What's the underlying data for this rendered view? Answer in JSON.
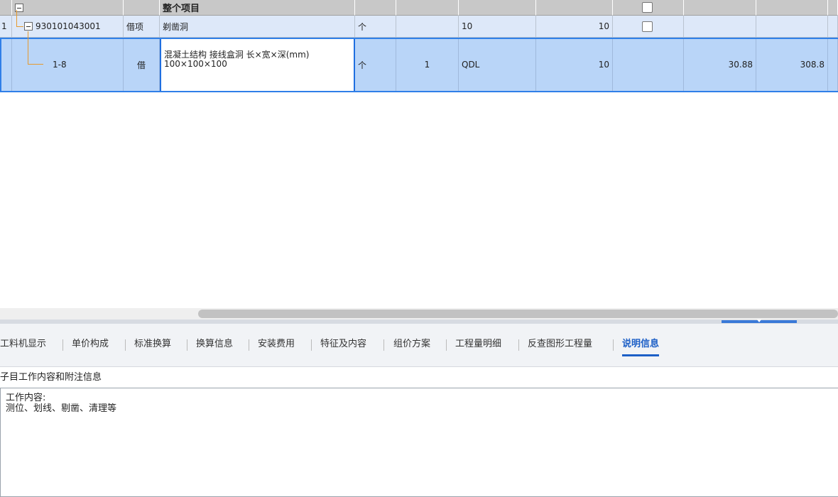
{
  "grid": {
    "header_row": {
      "name": "整个项目"
    },
    "list_row": {
      "num": "1",
      "code": "930101043001",
      "type": "借项",
      "name": "剃凿洞",
      "unit": "个",
      "quantity_expr": "10",
      "quantity": "10"
    },
    "sub_row": {
      "code": "1-8",
      "type": "借",
      "name": "混凝土结构 接线盒洞 长×宽×深(mm) 100×100×100",
      "unit": "个",
      "expr": "1",
      "quantity_expr": "QDL",
      "quantity": "10",
      "unit_price": "30.88",
      "total": "308.8"
    }
  },
  "tabs": [
    {
      "label": "工料机显示",
      "active": false
    },
    {
      "label": "单价构成",
      "active": false
    },
    {
      "label": "标准换算",
      "active": false
    },
    {
      "label": "换算信息",
      "active": false
    },
    {
      "label": "安装费用",
      "active": false
    },
    {
      "label": "特征及内容",
      "active": false
    },
    {
      "label": "组价方案",
      "active": false
    },
    {
      "label": "工程量明细",
      "active": false
    },
    {
      "label": "反查图形工程量",
      "active": false
    },
    {
      "label": "说明信息",
      "active": true
    }
  ],
  "description": {
    "title": "子目工作内容和附注信息",
    "content": "工作内容:\n测位、划线、剔凿、清理等"
  },
  "colors": {
    "accent": "#1c5fc6",
    "selection": "#b9d5f8",
    "tree_line": "#e69a2e"
  }
}
